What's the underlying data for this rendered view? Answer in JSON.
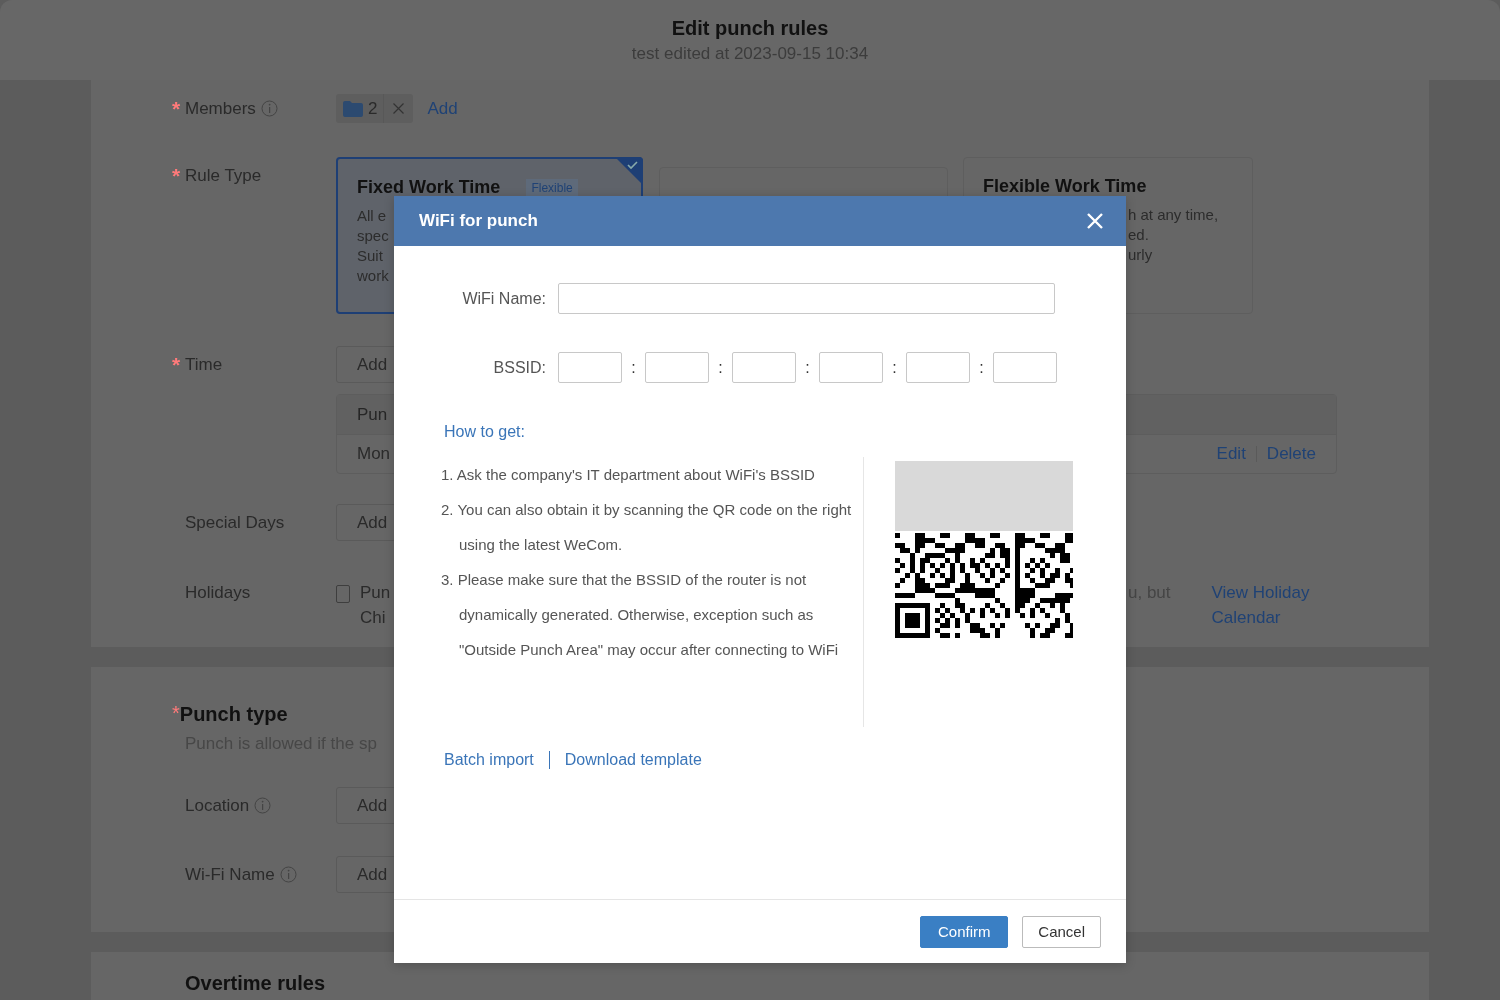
{
  "header": {
    "title": "Edit punch rules",
    "subtitle": "test edited at 2023-09-15 10:34"
  },
  "rules": {
    "members": {
      "mark": "*",
      "label": "Members",
      "chip_count": "2",
      "add_link": "Add"
    },
    "rule_type": {
      "mark": "*",
      "label": "Rule Type",
      "options": [
        {
          "title": "Fixed Work Time",
          "tag": "Flexible",
          "lines": [
            "All e",
            "spec",
            "Suit",
            "work"
          ],
          "selected": true
        },
        {
          "selected": false
        },
        {
          "title": "Flexible Work Time",
          "lines": [
            "h at any time,",
            "ed.",
            "urly"
          ],
          "selected": false
        }
      ]
    },
    "time": {
      "mark": "*",
      "label": "Time",
      "button": "Add",
      "table_header": "Pun",
      "table_row": "Mon",
      "actions": [
        "Edit",
        "Delete"
      ]
    },
    "special_days": {
      "label": "Special Days",
      "button": "Add"
    },
    "holidays": {
      "label": "Holidays",
      "checked": false,
      "lines": [
        "Pun",
        "Chi"
      ],
      "tail": "u, but",
      "link": "View Holiday Calendar"
    }
  },
  "punch_type": {
    "mark": "*",
    "title": "Punch type",
    "description": "Punch is allowed if the sp",
    "rows": [
      {
        "label": "Location",
        "button": "Add"
      },
      {
        "label": "Wi-Fi Name",
        "button": "Add"
      }
    ]
  },
  "overtime": {
    "title": "Overtime rules"
  },
  "dialog": {
    "title": "WiFi for punch",
    "name_label": "WiFi Name:",
    "bssid_label": "BSSID:",
    "bssid_separators": [
      ":",
      ":",
      ":",
      ":",
      ":"
    ],
    "help_link": "How to get:",
    "steps": [
      "1. Ask the company's IT department about WiFi's BSSID",
      "2. You can also obtain it by scanning the QR code on the right using the latest WeCom.",
      "3. Please make sure that the BSSID of the router is not dynamically generated. Otherwise, exception such as \"Outside Punch Area\" may occur after connecting to WiFi"
    ],
    "links": [
      "Batch import",
      "Download template"
    ],
    "buttons": [
      {
        "label": "Confirm",
        "kind": "primary"
      },
      {
        "label": "Cancel",
        "kind": "default"
      }
    ]
  }
}
